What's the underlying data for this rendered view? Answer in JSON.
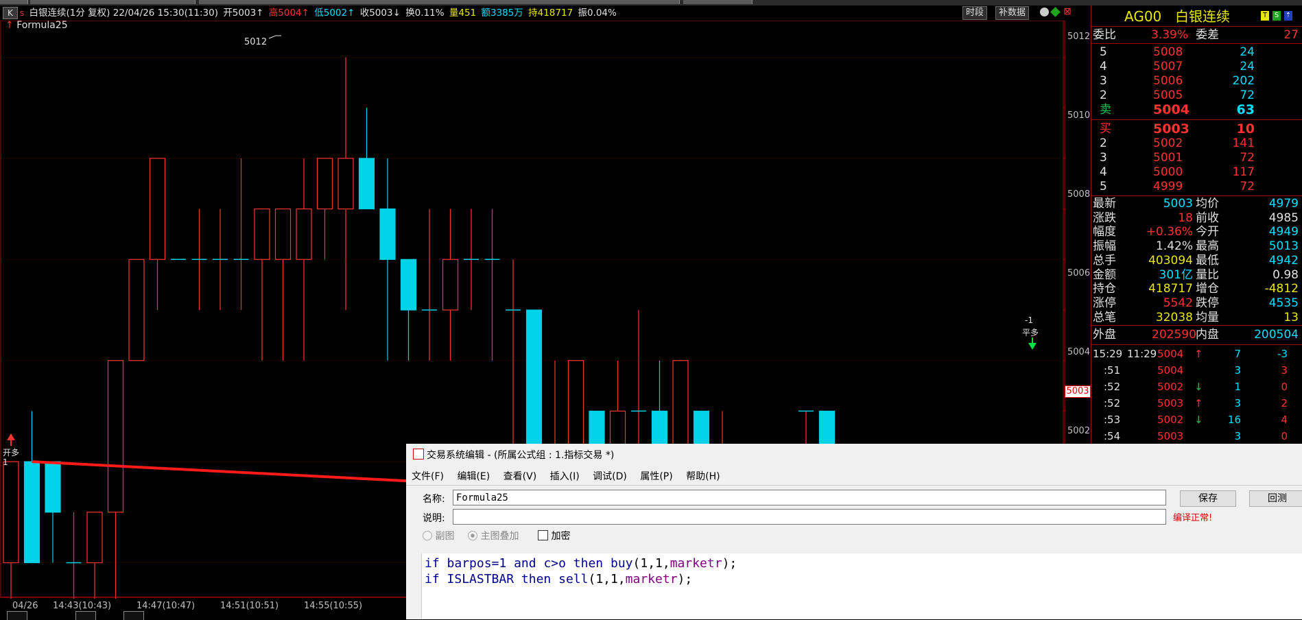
{
  "header": {
    "k_label": "K",
    "s_mark": "S",
    "title": "白银连续(1分 复权) 22/04/26 15:30(11:30)",
    "open": "开5003↑",
    "high": "高5004↑",
    "low": "低5002↑",
    "close": "收5003↓",
    "turnover": "换0.11%",
    "volume": "量451",
    "amount": "额3385万",
    "hold": "持418717",
    "amplitude": "振0.04%",
    "btn_period": "时段",
    "btn_supplement": "补数据",
    "formula_label": "Formula25"
  },
  "chart": {
    "y_labels": [
      "5012",
      "5010",
      "5008",
      "5006",
      "5004",
      "5002"
    ],
    "x_labels": [
      "04/26",
      "14:43(10:43)",
      "14:47(10:47)",
      "14:51(10:51)",
      "14:55(10:55)"
    ],
    "high_mark": "5012",
    "last_price_tag": "5003",
    "signal_open": "开多",
    "signal_open_qty": "1",
    "signal_close": "平多",
    "signal_close_qty": "-1",
    "colors": {
      "up": "#ff3232",
      "down": "#00d2e8",
      "trend": "#ff1a1a"
    }
  },
  "chart_data": {
    "type": "candlestick",
    "ylim": [
      5001.6,
      5012.4
    ],
    "candles": [
      {
        "o": 5002,
        "h": 5004,
        "l": 5001,
        "c": 5004
      },
      {
        "o": 5004,
        "h": 5005,
        "l": 5002,
        "c": 5002
      },
      {
        "o": 5004,
        "h": 5004,
        "l": 5002,
        "c": 5003
      },
      {
        "o": 5002,
        "h": 5003,
        "l": 5001,
        "c": 5002
      },
      {
        "o": 5002,
        "h": 5003,
        "l": 5001,
        "c": 5003
      },
      {
        "o": 5003,
        "h": 5006,
        "l": 5001,
        "c": 5006
      },
      {
        "o": 5006,
        "h": 5008,
        "l": 5006,
        "c": 5008
      },
      {
        "o": 5008,
        "h": 5010,
        "l": 5007,
        "c": 5010
      },
      {
        "o": 5008,
        "h": 5008,
        "l": 5008,
        "c": 5008
      },
      {
        "o": 5008,
        "h": 5009,
        "l": 5007,
        "c": 5008
      },
      {
        "o": 5008,
        "h": 5009,
        "l": 5007,
        "c": 5008
      },
      {
        "o": 5008,
        "h": 5010,
        "l": 5007,
        "c": 5008
      },
      {
        "o": 5008,
        "h": 5009,
        "l": 5006,
        "c": 5009
      },
      {
        "o": 5008,
        "h": 5009,
        "l": 5006,
        "c": 5009
      },
      {
        "o": 5008,
        "h": 5010,
        "l": 5006,
        "c": 5009
      },
      {
        "o": 5009,
        "h": 5010,
        "l": 5008,
        "c": 5010
      },
      {
        "o": 5009,
        "h": 5012,
        "l": 5007,
        "c": 5010
      },
      {
        "o": 5010,
        "h": 5011,
        "l": 5009,
        "c": 5009
      },
      {
        "o": 5009,
        "h": 5010,
        "l": 5006,
        "c": 5008
      },
      {
        "o": 5008,
        "h": 5008,
        "l": 5006,
        "c": 5007
      },
      {
        "o": 5007,
        "h": 5009,
        "l": 5006,
        "c": 5007
      },
      {
        "o": 5007,
        "h": 5009,
        "l": 5006,
        "c": 5008
      },
      {
        "o": 5008,
        "h": 5009,
        "l": 5007,
        "c": 5008
      },
      {
        "o": 5008,
        "h": 5009,
        "l": 5006,
        "c": 5008
      },
      {
        "o": 5007,
        "h": 5008,
        "l": 5004,
        "c": 5007
      },
      {
        "o": 5007,
        "h": 5007,
        "l": 5004,
        "c": 5004
      },
      {
        "o": 5004,
        "h": 5006,
        "l": 5004,
        "c": 5004
      },
      {
        "o": 5004,
        "h": 5006,
        "l": 5004,
        "c": 5006
      },
      {
        "o": 5005,
        "h": 5005,
        "l": 5003,
        "c": 5004
      },
      {
        "o": 5004,
        "h": 5006,
        "l": 5003,
        "c": 5005
      },
      {
        "o": 5005,
        "h": 5007,
        "l": 5003,
        "c": 5005
      },
      {
        "o": 5005,
        "h": 5006,
        "l": 5004,
        "c": 5004
      },
      {
        "o": 5004,
        "h": 5006,
        "l": 5004,
        "c": 5006
      },
      {
        "o": 5005,
        "h": 5005,
        "l": 5002,
        "c": 5003
      },
      {
        "o": 5004,
        "h": 5005,
        "l": 5003,
        "c": 5004
      },
      {
        "o": 5004,
        "h": 5004,
        "l": 5003,
        "c": 5003
      },
      {
        "o": 5004,
        "h": 5004,
        "l": 5003,
        "c": 5003
      },
      {
        "o": 5004,
        "h": 5004,
        "l": 5003,
        "c": 5004
      },
      {
        "o": 5005,
        "h": 5005,
        "l": 5003,
        "c": 5005
      },
      {
        "o": 5005,
        "h": 5005,
        "l": 5003,
        "c": 5003
      },
      {
        "o": 5004,
        "h": 5004,
        "l": 5003,
        "c": 5003
      },
      {
        "o": 5003,
        "h": 5003,
        "l": 5002,
        "c": 5002
      },
      {
        "o": 5002,
        "h": 5002,
        "l": 5001,
        "c": 5002
      },
      {
        "o": 5002,
        "h": 5002,
        "l": 5001,
        "c": 5002
      },
      {
        "o": 5002,
        "h": 5002,
        "l": 5001,
        "c": 5002
      },
      {
        "o": 5002,
        "h": 5002,
        "l": 5001,
        "c": 5002
      },
      {
        "o": 5002,
        "h": 5003,
        "l": 5001,
        "c": 5003
      },
      {
        "o": 5002,
        "h": 5002,
        "l": 5001,
        "c": 5002
      },
      {
        "o": 5002,
        "h": 5002,
        "l": 5001,
        "c": 5002
      },
      {
        "o": 5003,
        "h": 5003,
        "l": 5001,
        "c": 5003
      },
      {
        "o": 5003,
        "h": 5003,
        "l": 5001,
        "c": 5002
      },
      {
        "o": 5003,
        "h": 5003,
        "l": 5001,
        "c": 5003
      },
      {
        "o": 5003,
        "h": 5004,
        "l": 5002,
        "c": 5003
      }
    ],
    "trendline": {
      "from": [
        1,
        5004.0
      ],
      "to": [
        48,
        5003.0
      ]
    }
  },
  "quote": {
    "symbol": "AG00",
    "name": "白银连续",
    "wei_bi_label": "委比",
    "wei_bi": "3.39%",
    "wei_cha_label": "委差",
    "wei_cha": "27",
    "asks": [
      {
        "lvl": "5",
        "price": "5008",
        "vol": "24"
      },
      {
        "lvl": "4",
        "price": "5007",
        "vol": "24"
      },
      {
        "lvl": "3",
        "price": "5006",
        "vol": "202"
      },
      {
        "lvl": "2",
        "price": "5005",
        "vol": "72"
      },
      {
        "lvl": "卖",
        "price": "5004",
        "vol": "63"
      }
    ],
    "bids": [
      {
        "lvl": "买",
        "price": "5003",
        "vol": "10"
      },
      {
        "lvl": "2",
        "price": "5002",
        "vol": "141"
      },
      {
        "lvl": "3",
        "price": "5001",
        "vol": "72"
      },
      {
        "lvl": "4",
        "price": "5000",
        "vol": "117"
      },
      {
        "lvl": "5",
        "price": "4999",
        "vol": "72"
      }
    ],
    "stats": [
      {
        "k1": "最新",
        "v1": "5003",
        "k2": "均价",
        "v2": "4979"
      },
      {
        "k1": "涨跌",
        "v1": "18",
        "k2": "前收",
        "v2": "4985"
      },
      {
        "k1": "幅度",
        "v1": "+0.36%",
        "k2": "今开",
        "v2": "4949"
      },
      {
        "k1": "振幅",
        "v1": "1.42%",
        "k2": "最高",
        "v2": "5013"
      },
      {
        "k1": "总手",
        "v1": "403094",
        "k2": "最低",
        "v2": "4942"
      },
      {
        "k1": "金额",
        "v1": "301亿",
        "k2": "量比",
        "v2": "0.98"
      },
      {
        "k1": "持仓",
        "v1": "418717",
        "k2": "增仓",
        "v2": "-4812"
      },
      {
        "k1": "涨停",
        "v1": "5542",
        "k2": "跌停",
        "v2": "4535"
      },
      {
        "k1": "总笔",
        "v1": "32038",
        "k2": "均量",
        "v2": "13"
      }
    ],
    "outer_label": "外盘",
    "outer": "202590",
    "inner_label": "内盘",
    "inner": "200504",
    "ticks": [
      {
        "time": "15:29",
        "time2": "11:29",
        "price": "5004",
        "arrow": "↑",
        "vol": "7",
        "chg": "-3"
      },
      {
        "time": ":51",
        "time2": "",
        "price": "5004",
        "arrow": "",
        "vol": "3",
        "chg": "3"
      },
      {
        "time": ":52",
        "time2": "",
        "price": "5002",
        "arrow": "↓",
        "vol": "1",
        "chg": "0"
      },
      {
        "time": ":52",
        "time2": "",
        "price": "5003",
        "arrow": "↑",
        "vol": "3",
        "chg": "2"
      },
      {
        "time": ":53",
        "time2": "",
        "price": "5002",
        "arrow": "↓",
        "vol": "16",
        "chg": "4"
      },
      {
        "time": ":54",
        "time2": "",
        "price": "5003",
        "arrow": "",
        "vol": "3",
        "chg": "0"
      }
    ]
  },
  "editor": {
    "title": "交易系统编辑 - (所属公式组 : 1.指标交易 *)",
    "menu": [
      "文件(F)",
      "编辑(E)",
      "查看(V)",
      "插入(I)",
      "调试(D)",
      "属性(P)",
      "帮助(H)"
    ],
    "name_label": "名称:",
    "name_value": "Formula25",
    "desc_label": "说明:",
    "desc_value": "",
    "radio_sub": "副图",
    "radio_main": "主图叠加",
    "encrypt_label": "加密",
    "save_label": "保存",
    "backtest_label": "回测",
    "compile_status": "编译正常!",
    "code_line1": {
      "kw1": "if",
      "w1": "barpos=1",
      "kw2": "and",
      "w2": "c>o",
      "kw3": "then",
      "fn": "buy",
      "args": "(1,1,",
      "arg_fn": "marketr",
      "tail": ");"
    },
    "code_line2": {
      "kw1": "if",
      "w1": "ISLASTBAR",
      "kw3": "then",
      "fn": "sell",
      "args": "(1,1,",
      "arg_fn": "marketr",
      "tail": ");"
    }
  }
}
